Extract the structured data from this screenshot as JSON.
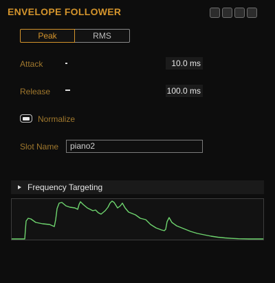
{
  "plugin": {
    "title": "ENVELOPE FOLLOWER"
  },
  "window_buttons": [
    "minimize-button",
    "maximize-button",
    "restore-button",
    "close-button"
  ],
  "mode": {
    "options": [
      "Peak",
      "RMS"
    ],
    "selected": "Peak"
  },
  "attack": {
    "label": "Attack",
    "value": "10.0 ms"
  },
  "release": {
    "label": "Release",
    "value": "100.0 ms"
  },
  "normalize": {
    "label": "Normalize",
    "checked": true
  },
  "slot_name": {
    "label": "Slot Name",
    "value": "piano2"
  },
  "frequency_targeting": {
    "label": "Frequency Targeting",
    "expanded": false
  },
  "colors": {
    "accent": "#d4942c",
    "envelope": "#6fd66f"
  }
}
